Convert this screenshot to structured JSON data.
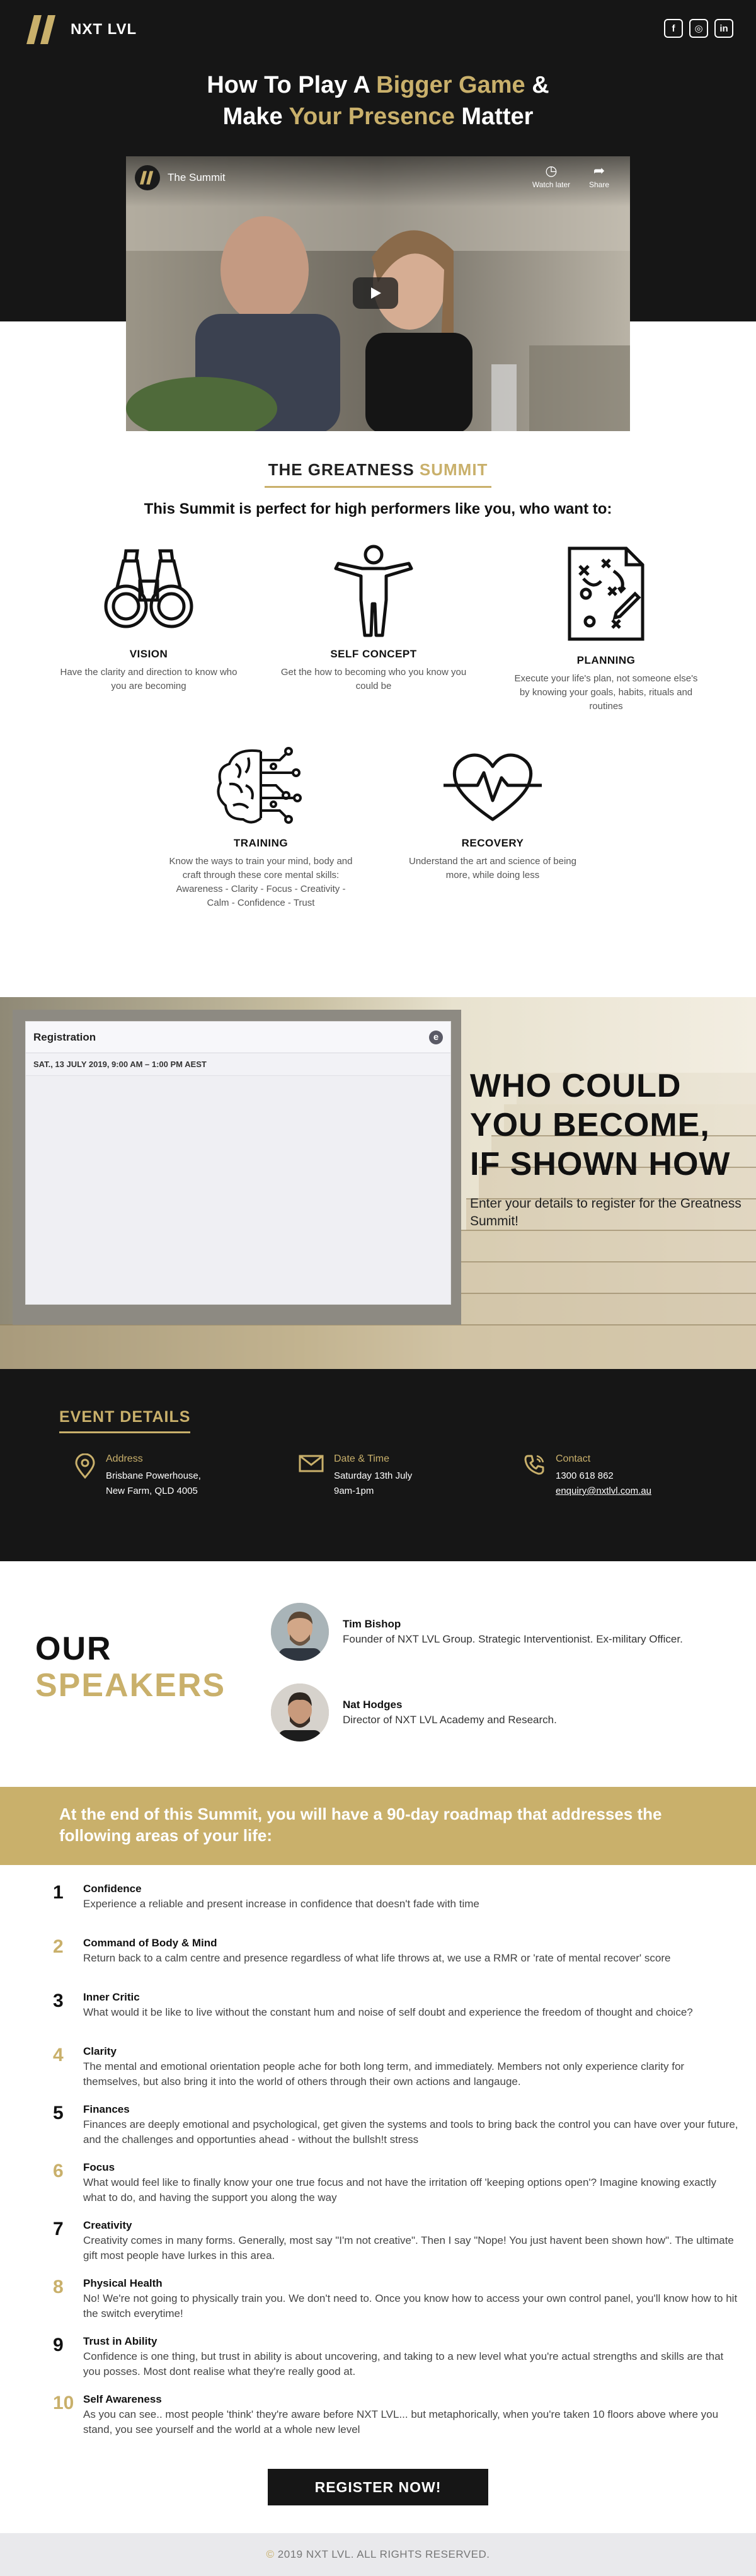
{
  "header": {
    "logo_text": "NXT LVL",
    "socials": [
      {
        "icon": "facebook-icon",
        "glyph": "f"
      },
      {
        "icon": "instagram-icon",
        "glyph": "◎"
      },
      {
        "icon": "linkedin-icon",
        "glyph": "in"
      }
    ],
    "title_part1": "How To Play A ",
    "title_gold1": "Bigger Game",
    "title_part2": " &",
    "title_part3": "Make ",
    "title_gold2": "Your Presence",
    "title_part4": " Matter"
  },
  "video": {
    "title": "The Summit",
    "watch_later": "Watch later",
    "share": "Share"
  },
  "summit": {
    "heading_pre": "THE ",
    "heading_bold": "GREATNESS",
    "heading_gold": " SUMMIT",
    "subheading": "This Summit is perfect for high performers like you, who want to:",
    "features": [
      {
        "title": "VISION",
        "desc": "Have the clarity and direction to know who you are becoming"
      },
      {
        "title": "SELF CONCEPT",
        "desc": "Get the how to becoming who you know you could be"
      },
      {
        "title": "PLANNING",
        "desc": "Execute your life's plan, not someone else's by knowing your goals, habits, rituals and routines"
      },
      {
        "title": "TRAINING",
        "desc": "Know the ways to train your mind, body and craft through these core mental skills: Awareness - Clarity - Focus - Creativity - Calm - Confidence - Trust"
      },
      {
        "title": "RECOVERY",
        "desc": "Understand the art and science of being more, while doing less"
      }
    ]
  },
  "registration": {
    "title": "Registration",
    "date": "SAT., 13 JULY 2019, 9:00 AM – 1:00 PM AEST",
    "who_line1": "WHO COULD",
    "who_line2": "YOU BECOME,",
    "who_line3": "IF SHOWN HOW",
    "who_sub": "Enter your details to register for the Greatness Summit!"
  },
  "event": {
    "heading": "EVENT DETAILS",
    "address_label": "Address",
    "address_line1": "Brisbane Powerhouse,",
    "address_line2": "New Farm, QLD 4005",
    "date_label": "Date & Time",
    "date_line1": "Saturday 13th July",
    "date_line2": "9am-1pm",
    "contact_label": "Contact",
    "contact_phone": "1300 618 862",
    "contact_email": "enquiry@nxtlvl.com.au"
  },
  "speakers": {
    "heading_line1": "OUR",
    "heading_line2": "SPEAKERS",
    "list": [
      {
        "name": "Tim Bishop",
        "role": "Founder of NXT LVL Group. Strategic Interventionist. Ex-military Officer."
      },
      {
        "name": "Nat Hodges",
        "role": "Director of NXT LVL Academy and Research."
      }
    ]
  },
  "roadmap": {
    "banner": "At the end of this Summit, you will have a 90-day roadmap that addresses the following areas of your life:",
    "items": [
      {
        "num": "1",
        "title": "Confidence",
        "desc": "Experience a reliable and present increase in confidence that doesn't fade with time"
      },
      {
        "num": "2",
        "title": "Command of Body & Mind",
        "desc": "Return back to a calm centre and presence regardless of what life throws at, we use a RMR or 'rate of mental recover' score"
      },
      {
        "num": "3",
        "title": "Inner Critic",
        "desc": "What would it be like to live without the constant hum and noise of self doubt and experience the freedom of thought and choice?"
      },
      {
        "num": "4",
        "title": "Clarity",
        "desc": "The mental and emotional orientation people ache for both long term, and immediately. Members not only experience clarity for themselves, but also bring it into the world of others through their own actions and langauge."
      },
      {
        "num": "5",
        "title": "Finances",
        "desc": "Finances are deeply emotional and psychological, get given the systems and tools to bring back the control you can have over your future, and the challenges and opportunties ahead - without the bullsh!t stress"
      },
      {
        "num": "6",
        "title": "Focus",
        "desc": "What would feel like to finally know your one true focus and not have the irritation off 'keeping options open'? Imagine knowing exactly what to do, and having the support you along the way"
      },
      {
        "num": "7",
        "title": "Creativity",
        "desc": "Creativity comes in many forms. Generally, most say \"I'm not creative\". Then I say \"Nope! You just havent been shown how\". The ultimate gift most people have lurkes in this area."
      },
      {
        "num": "8",
        "title": "Physical Health",
        "desc": "No! We're not going to physically train you. We don't need to. Once you know how to access your own control panel, you'll know how to hit the switch everytime!"
      },
      {
        "num": "9",
        "title": "Trust in Ability",
        "desc": "Confidence is one thing, but trust in ability is about uncovering, and taking to a new level what you're actual strengths and skills are that you posses. Most dont realise what they're really good at."
      },
      {
        "num": "10",
        "title": "Self Awareness",
        "desc": "As you can see.. most people 'think' they're aware before NXT LVL... but metaphorically, when you're taken 10 floors above where you stand, you see yourself and the world at a whole new level"
      }
    ],
    "register_label": "REGISTER NOW!"
  },
  "footer": {
    "copyright_symbol": "©",
    "text": " 2019 NXT LVL. ALL RIGHTS RESERVED."
  },
  "colors": {
    "gold": "#c9b06b",
    "dark": "#161616"
  }
}
